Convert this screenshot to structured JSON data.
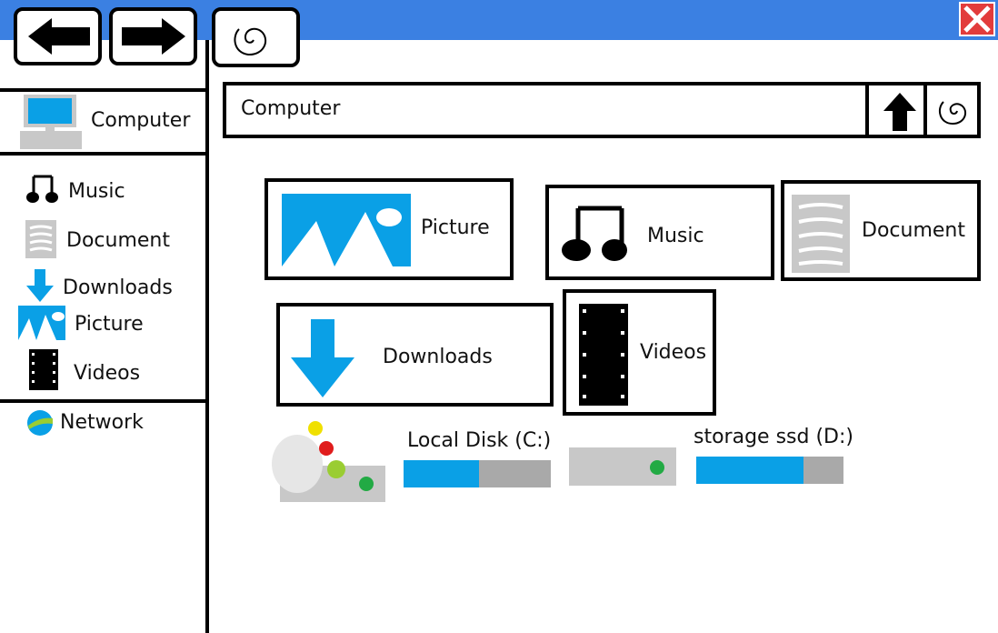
{
  "window": {
    "accent": "#3b80e2"
  },
  "toolbar": {
    "back_icon": "arrow-left-icon",
    "forward_icon": "arrow-right-icon",
    "refresh_icon": "refresh-icon",
    "close_icon": "close-icon"
  },
  "sidebar": {
    "computer": {
      "label": "Computer",
      "icon": "computer-icon"
    },
    "items": [
      {
        "label": "Music",
        "icon": "music-icon"
      },
      {
        "label": "Document",
        "icon": "document-icon"
      },
      {
        "label": "Downloads",
        "icon": "download-icon"
      },
      {
        "label": "Picture",
        "icon": "picture-icon"
      },
      {
        "label": "Videos",
        "icon": "video-icon"
      }
    ],
    "network": {
      "label": "Network",
      "icon": "network-icon"
    }
  },
  "address_bar": {
    "value": "Computer",
    "up_icon": "up-arrow-icon",
    "refresh_icon": "refresh-icon"
  },
  "folders": [
    {
      "label": "Picture",
      "icon": "picture-icon"
    },
    {
      "label": "Music",
      "icon": "music-icon"
    },
    {
      "label": "Document",
      "icon": "document-icon"
    },
    {
      "label": "Downloads",
      "icon": "download-icon"
    },
    {
      "label": "Videos",
      "icon": "video-icon"
    }
  ],
  "drives": [
    {
      "label": "Local Disk (C:)",
      "icon": "system-drive-icon",
      "used_fraction": 0.51
    },
    {
      "label": "storage ssd (D:)",
      "icon": "drive-icon",
      "used_fraction": 0.73
    }
  ]
}
